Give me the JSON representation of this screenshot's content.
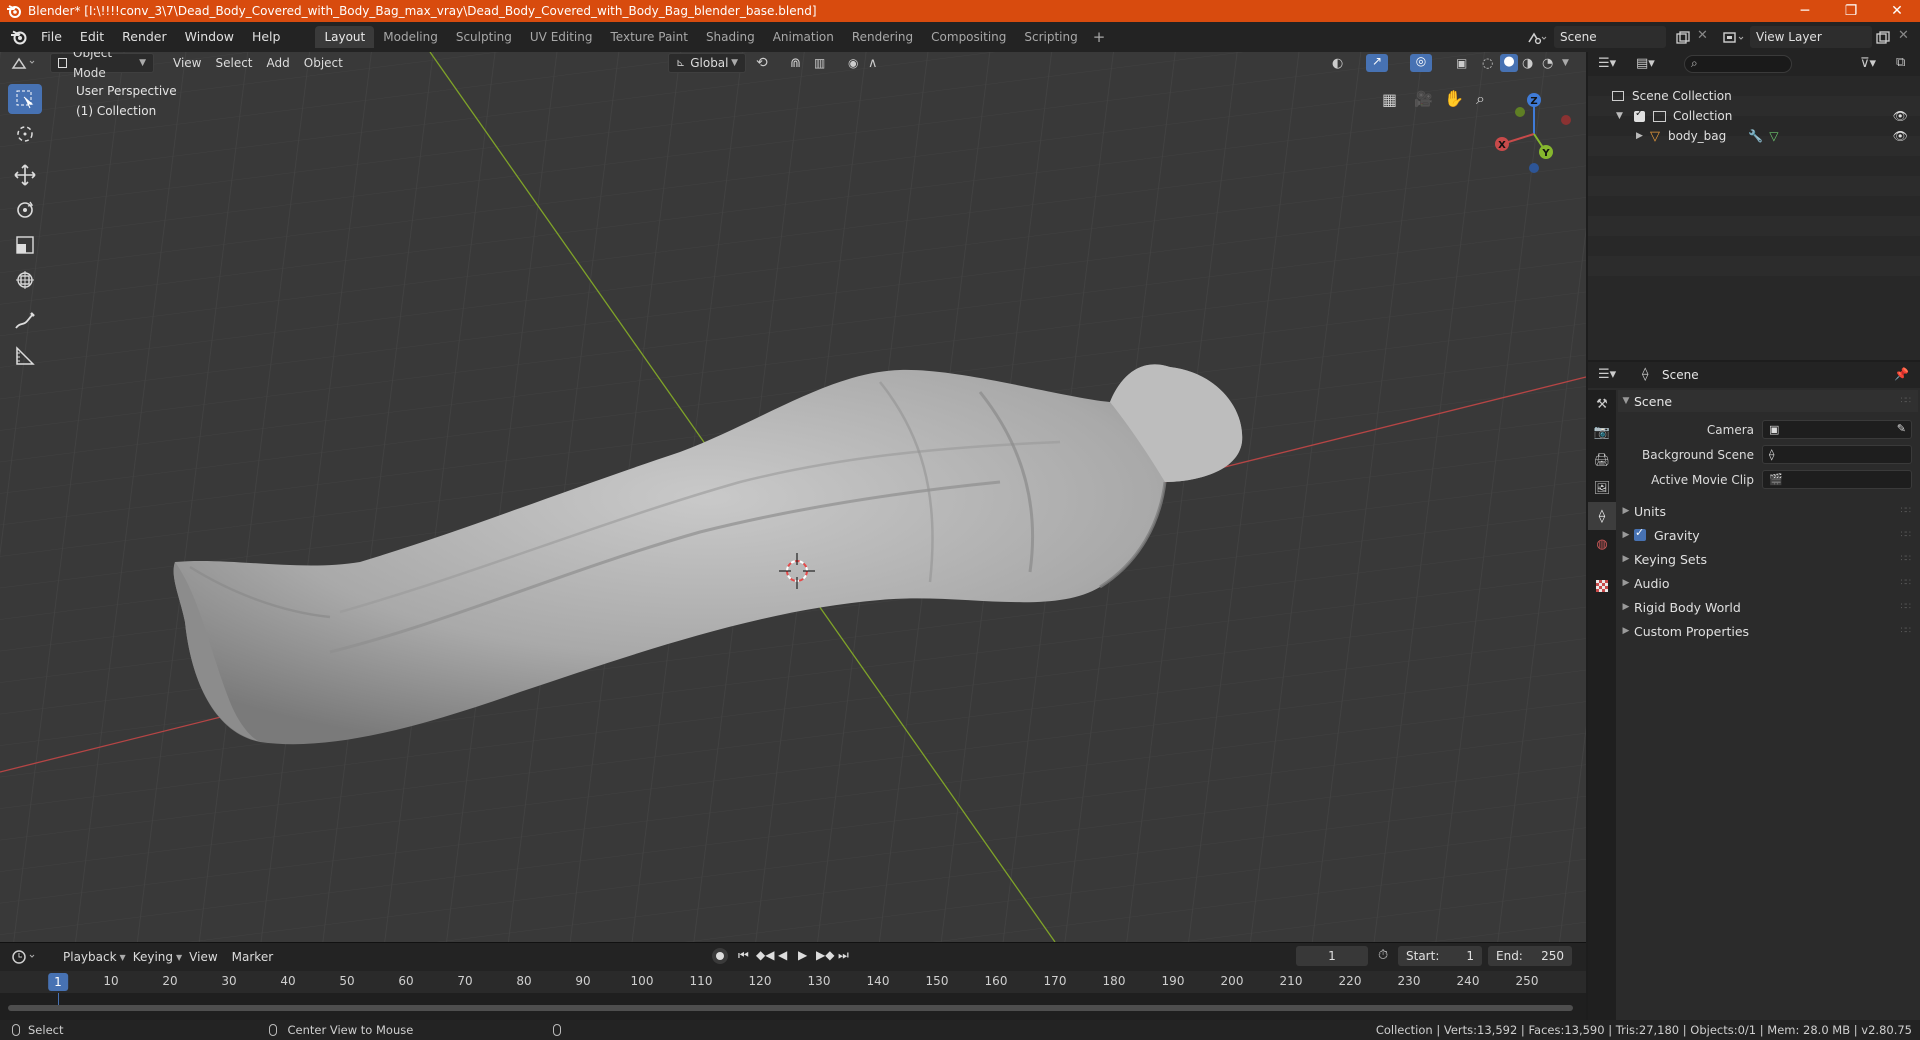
{
  "window": {
    "title": "Blender* [I:\\!!!!conv_3\\7\\Dead_Body_Covered_with_Body_Bag_max_vray\\Dead_Body_Covered_with_Body_Bag_blender_base.blend]",
    "minimize": "─",
    "maximize": "❐",
    "close": "✕"
  },
  "menu": [
    "File",
    "Edit",
    "Render",
    "Window",
    "Help"
  ],
  "workspaces": [
    "Layout",
    "Modeling",
    "Sculpting",
    "UV Editing",
    "Texture Paint",
    "Shading",
    "Animation",
    "Rendering",
    "Compositing",
    "Scripting"
  ],
  "active_workspace": "Layout",
  "scene_selector": {
    "value": "Scene"
  },
  "viewlayer_selector": {
    "value": "View Layer"
  },
  "viewport": {
    "mode": "Object Mode",
    "menus": [
      "View",
      "Select",
      "Add",
      "Object"
    ],
    "transform_orientation": "Global",
    "info_line1": "User Perspective",
    "info_line2": "(1) Collection",
    "gizmo": {
      "x": "X",
      "y": "Y",
      "z": "Z"
    }
  },
  "timeline": {
    "menus": [
      "Playback",
      "Keying",
      "View",
      "Marker"
    ],
    "current_frame": "1",
    "start_label": "Start:",
    "start": "1",
    "end_label": "End:",
    "end": "250",
    "ticks": [
      "10",
      "20",
      "30",
      "40",
      "50",
      "60",
      "70",
      "80",
      "90",
      "100",
      "110",
      "120",
      "130",
      "140",
      "150",
      "160",
      "170",
      "180",
      "190",
      "200",
      "210",
      "220",
      "230",
      "240",
      "250"
    ]
  },
  "status": {
    "select": "Select",
    "center_view": "Center View to Mouse",
    "stats": "Collection | Verts:13,592 | Faces:13,590 | Tris:27,180 | Objects:0/1 | Mem: 28.0 MB | v2.80.75"
  },
  "outliner": {
    "scene_collection": "Scene Collection",
    "collection": "Collection",
    "object": "body_bag"
  },
  "properties": {
    "context": "Scene",
    "panel_title": "Scene",
    "camera_label": "Camera",
    "background_scene_label": "Background Scene",
    "active_movie_clip_label": "Active Movie Clip",
    "subpanels": [
      "Units",
      "Gravity",
      "Keying Sets",
      "Audio",
      "Rigid Body World",
      "Custom Properties"
    ]
  },
  "colors": {
    "title_bar": "#d84b0e",
    "accent": "#4772b3",
    "axis_x": "#c84a4a",
    "axis_y": "#86b72e",
    "axis_z": "#3f7bd8"
  }
}
